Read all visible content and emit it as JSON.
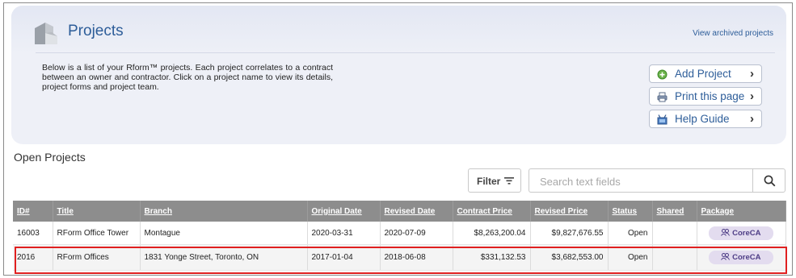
{
  "header": {
    "title": "Projects",
    "archived_link": "View archived projects",
    "intro": "Below is a list of your Rform™ projects. Each project correlates to a contract between an owner and contractor. Click on a project name to view its details, project forms and project team."
  },
  "actions": [
    {
      "label": "Add Project",
      "icon": "add-icon"
    },
    {
      "label": "Print this page",
      "icon": "printer-icon"
    },
    {
      "label": "Help Guide",
      "icon": "help-guide-icon"
    }
  ],
  "open_projects": {
    "title": "Open Projects",
    "filter_label": "Filter",
    "search_placeholder": "Search text fields"
  },
  "table": {
    "columns": [
      "ID#",
      "Title",
      "Branch",
      "Original Date",
      "Revised Date",
      "Contract Price",
      "Revised Price",
      "Status",
      "Shared",
      "Package"
    ],
    "rows": [
      {
        "id": "16003",
        "title": "RForm Office Tower",
        "branch": "Montague",
        "original_date": "2020-03-31",
        "revised_date": "2020-07-09",
        "contract_price": "$8,263,200.04",
        "revised_price": "$9,827,676.55",
        "status": "Open",
        "shared": "",
        "package": "CoreCA"
      },
      {
        "id": "2016",
        "title": "RForm Offices",
        "branch": "1831 Yonge Street, Toronto, ON",
        "original_date": "2017-01-04",
        "revised_date": "2018-06-08",
        "contract_price": "$331,132.53",
        "revised_price": "$3,682,553.00",
        "status": "Open",
        "shared": "",
        "package": "CoreCA"
      }
    ]
  },
  "colors": {
    "accent": "#2d5d99",
    "table_header": "#8d8d8d",
    "badge_bg": "#e3dcef",
    "highlight": "#e02020"
  }
}
